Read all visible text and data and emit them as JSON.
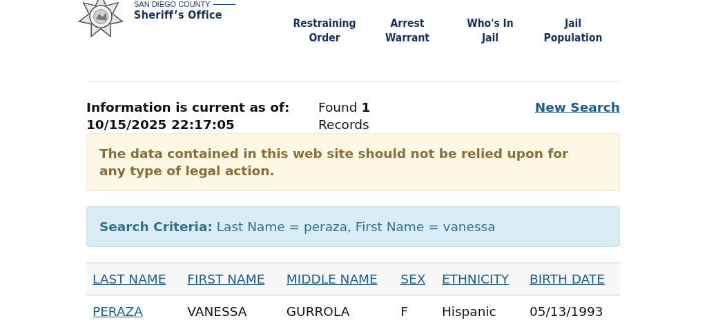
{
  "header": {
    "logo_top": "SAN DIEGO COUNTY",
    "logo_name": "Sheriff’s Office",
    "nav": [
      {
        "label": "Restraining\nOrder"
      },
      {
        "label": "Arrest\nWarrant"
      },
      {
        "label": "Who's In\nJail"
      },
      {
        "label": "Jail\nPopulation"
      }
    ]
  },
  "info": {
    "current": "Information is current as of: 10/15/2025 22:17:05",
    "found": "Found **1** Records",
    "new_search": "New Search"
  },
  "warning": "The data contained in this web site should not be relied upon for any type of legal action.",
  "criteria": {
    "label": "Search Criteria:",
    "value": "Last Name = peraza, First Name = vanessa"
  },
  "table": {
    "columns": [
      "LAST NAME",
      "FIRST NAME",
      "MIDDLE NAME",
      "SEX",
      "ETHNICITY",
      "BIRTH DATE"
    ],
    "rows": [
      [
        "PERAZA",
        "VANESSA",
        "GURROLA",
        "F",
        "Hispanic",
        "05/13/1993"
      ]
    ]
  }
}
